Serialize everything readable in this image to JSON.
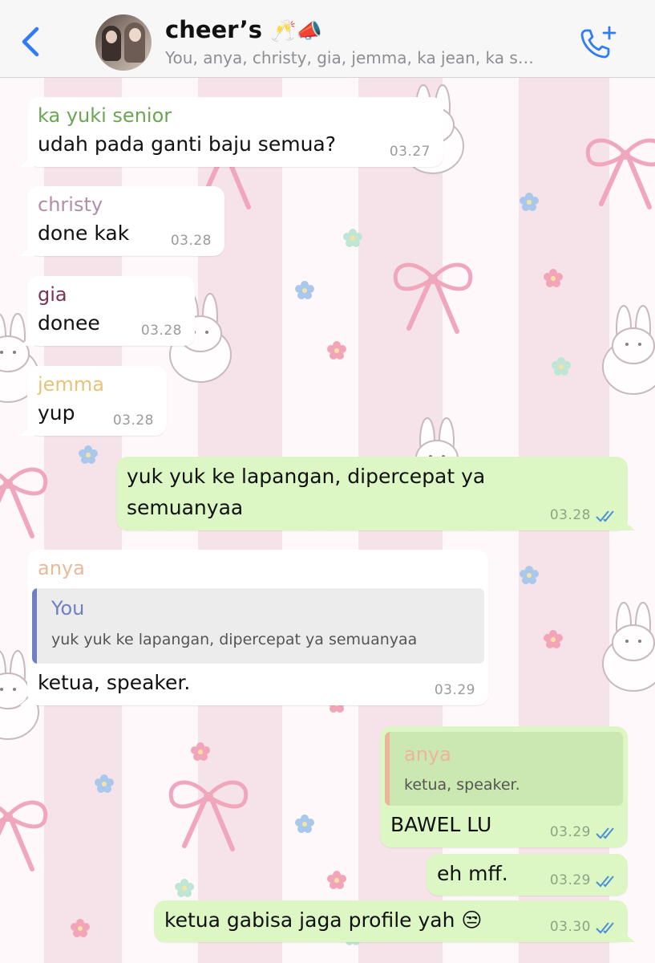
{
  "header": {
    "title": "cheer’s",
    "title_emoji": "🥂📣",
    "subtitle": "You, anya, christy, gia, jemma, ka jean, ka s…"
  },
  "colors": {
    "accent": "#2f7cf6",
    "outgoing_bubble": "#dcf6c4",
    "incoming_bubble": "#ffffff",
    "read_ticks": "#4a8fd8"
  },
  "messages": [
    {
      "sender": "ka yuki senior",
      "sender_color": "#6aa653",
      "text": "udah pada ganti baju semua?",
      "time": "03.27"
    },
    {
      "sender": "christy",
      "sender_color": "#b48ca8",
      "text": "done kak",
      "time": "03.28"
    },
    {
      "sender": "gia",
      "sender_color": "#7a3352",
      "text": "donee",
      "time": "03.28"
    },
    {
      "sender": "jemma",
      "sender_color": "#e7c37a",
      "text": "yup",
      "time": "03.28"
    },
    {
      "sender": "You",
      "lines": [
        "yuk yuk ke lapangan, dipercepat ya",
        "semuanyaa"
      ],
      "time": "03.28",
      "status": "read"
    },
    {
      "sender": "anya",
      "sender_color": "#e8b99a",
      "reply_to": {
        "name": "You",
        "text": "yuk yuk ke lapangan, dipercepat ya semuanyaa"
      },
      "text": "ketua, speaker.",
      "time": "03.29"
    },
    {
      "sender": "You",
      "reply_to": {
        "name": "anya",
        "text": "ketua, speaker."
      },
      "text": "BAWEL LU",
      "time": "03.29",
      "status": "read"
    },
    {
      "sender": "You",
      "text": "eh mff.",
      "time": "03.29",
      "status": "read"
    },
    {
      "sender": "You",
      "text": "ketua gabisa jaga profile yah 😒",
      "time": "03.30",
      "status": "read"
    }
  ]
}
